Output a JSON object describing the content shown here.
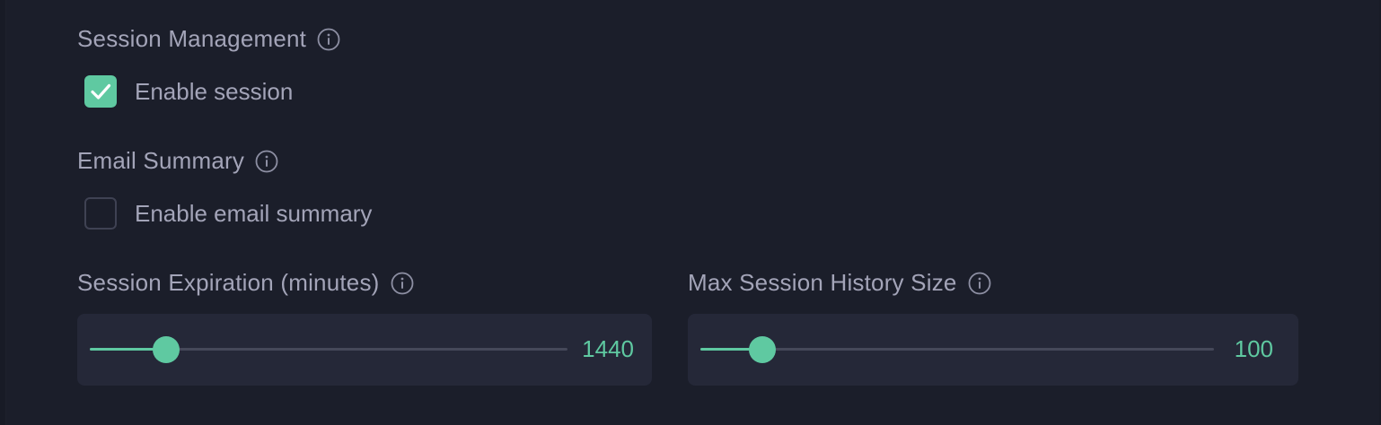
{
  "session_management": {
    "title": "Session Management",
    "enable_label": "Enable session",
    "enabled": true
  },
  "email_summary": {
    "title": "Email Summary",
    "enable_label": "Enable email summary",
    "enabled": false
  },
  "session_expiration": {
    "label": "Session Expiration (minutes)",
    "value": "1440",
    "fill_fraction": 0.16
  },
  "max_history": {
    "label": "Max Session History Size",
    "value": "100",
    "fill_fraction": 0.12
  },
  "colors": {
    "accent": "#5fc9a1",
    "background": "#1b1e2a",
    "card": "#252838",
    "text_muted": "#a3a4b8"
  },
  "icons": {
    "info": "info-circle-icon",
    "check": "check-icon"
  }
}
